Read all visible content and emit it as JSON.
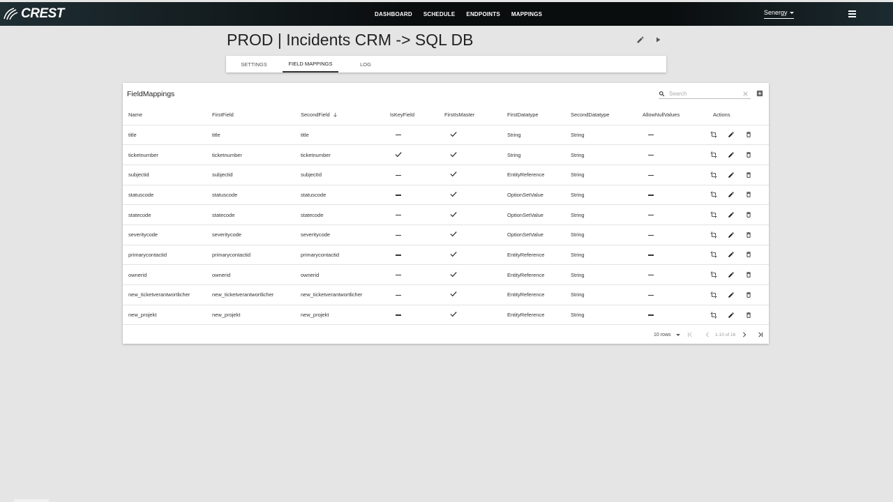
{
  "header": {
    "brand": "CREST",
    "nav": [
      "DASHBOARD",
      "SCHEDULE",
      "ENDPOINTS",
      "MAPPINGS"
    ],
    "account": "Senergy"
  },
  "page": {
    "title": "PROD | Incidents CRM -> SQL DB",
    "tabs": [
      "SETTINGS",
      "FIELD MAPPINGS",
      "LOG"
    ],
    "active_tab": "FIELD MAPPINGS"
  },
  "card": {
    "title": "FieldMappings",
    "search_placeholder": "Search",
    "columns": [
      "Name",
      "FirstField",
      "SecondField",
      "IsKeyField",
      "FirstIsMaster",
      "FirstDatatype",
      "SecondDatatype",
      "AllowNullValues",
      "Actions"
    ],
    "sorted_column": "SecondField",
    "sort_direction": "descending",
    "rows": [
      {
        "name": "title",
        "first": "title",
        "second": "title",
        "key": false,
        "master": true,
        "ft": "String",
        "st": "String",
        "nulls": false
      },
      {
        "name": "ticketnumber",
        "first": "ticketnumber",
        "second": "ticketnumber",
        "key": true,
        "master": true,
        "ft": "String",
        "st": "String",
        "nulls": false
      },
      {
        "name": "subjectid",
        "first": "subjectid",
        "second": "subjectId",
        "key": false,
        "master": true,
        "ft": "EntityReference",
        "st": "String",
        "nulls": false
      },
      {
        "name": "statuscode",
        "first": "statuscode",
        "second": "statuscode",
        "key": false,
        "master": true,
        "ft": "OptionSetValue",
        "st": "String",
        "nulls": false
      },
      {
        "name": "statecode",
        "first": "statecode",
        "second": "statecode",
        "key": false,
        "master": true,
        "ft": "OptionSetValue",
        "st": "String",
        "nulls": false
      },
      {
        "name": "severitycode",
        "first": "severitycode",
        "second": "severitycode",
        "key": false,
        "master": true,
        "ft": "OptionSetValue",
        "st": "String",
        "nulls": false
      },
      {
        "name": "primarycontactid",
        "first": "primarycontactid",
        "second": "primarycontactid",
        "key": false,
        "master": true,
        "ft": "EntityReference",
        "st": "String",
        "nulls": false
      },
      {
        "name": "ownerid",
        "first": "ownerid",
        "second": "ownerid",
        "key": false,
        "master": true,
        "ft": "EntityReference",
        "st": "String",
        "nulls": false
      },
      {
        "name": "new_ticketverantwortlicher",
        "first": "new_ticketverantwortlicher",
        "second": "new_ticketverantwortlicher",
        "key": false,
        "master": true,
        "ft": "EntityReference",
        "st": "String",
        "nulls": false
      },
      {
        "name": "new_projekt",
        "first": "new_projekt",
        "second": "new_projekt",
        "key": false,
        "master": true,
        "ft": "EntityReference",
        "st": "String",
        "nulls": false
      }
    ],
    "rows_per_page": "10 rows",
    "range": "1-10 of 16"
  },
  "colors": {
    "topbar": "#0a0d0e",
    "background": "#e5e5e5",
    "accent": "#333333"
  }
}
